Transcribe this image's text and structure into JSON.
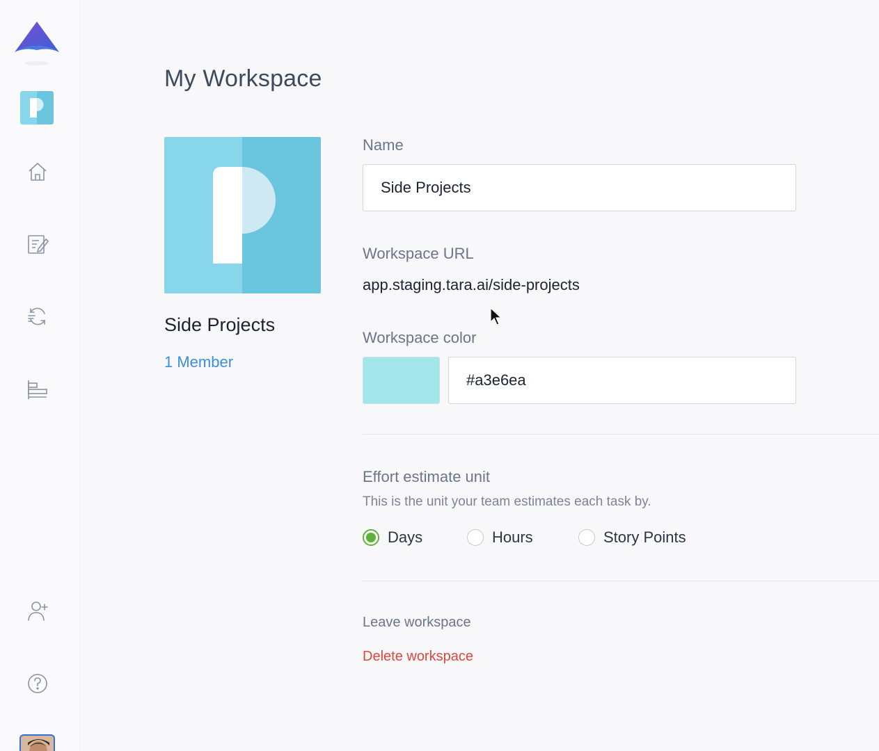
{
  "page": {
    "title": "My Workspace"
  },
  "sidebar": {
    "items": [
      {
        "name": "workspace-tile",
        "letter": "P"
      },
      {
        "name": "home-icon"
      },
      {
        "name": "edit-icon"
      },
      {
        "name": "sprint-icon"
      },
      {
        "name": "roadmap-icon"
      },
      {
        "name": "add-member-icon"
      },
      {
        "name": "help-icon"
      }
    ]
  },
  "workspace": {
    "name": "Side Projects",
    "members": "1 Member",
    "color": "#a3e6ea"
  },
  "form": {
    "name_label": "Name",
    "name_value": "Side Projects",
    "url_label": "Workspace URL",
    "url_value": "app.staging.tara.ai/side-projects",
    "color_label": "Workspace color",
    "color_value": "#a3e6ea"
  },
  "effort": {
    "label": "Effort estimate unit",
    "description": "This is the unit your team estimates each task by.",
    "options": [
      "Days",
      "Hours",
      "Story Points"
    ],
    "selected": "Days"
  },
  "actions": {
    "leave": "Leave workspace",
    "delete": "Delete workspace"
  },
  "colors": {
    "accent_link": "#3b8fe0",
    "danger": "#e0453d",
    "radio_checked": "#5cb337",
    "tile_light": "#87d6ec",
    "tile_dark": "#6ac6df"
  }
}
